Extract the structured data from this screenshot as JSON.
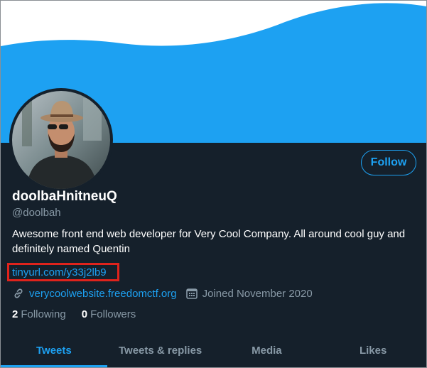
{
  "profile": {
    "display_name": "doolbaHnitneuQ",
    "handle": "@doolbah",
    "bio": "Awesome front end web developer for Very Cool Company. All around cool guy and definitely named Quentin",
    "bio_link": "tinyurl.com/y33j2lb9",
    "website": "verycoolwebsite.freedomctf.org",
    "joined": "Joined November 2020"
  },
  "actions": {
    "follow_label": "Follow"
  },
  "stats": {
    "following_count": "2",
    "following_label": "Following",
    "followers_count": "0",
    "followers_label": "Followers"
  },
  "tabs": [
    {
      "label": "Tweets",
      "active": true
    },
    {
      "label": "Tweets & replies",
      "active": false
    },
    {
      "label": "Media",
      "active": false
    },
    {
      "label": "Likes",
      "active": false
    }
  ],
  "icons": {
    "website": "link-icon",
    "joined": "calendar-icon"
  },
  "colors": {
    "background": "#15202b",
    "accent": "#1da1f2",
    "secondary_text": "#8899a6",
    "highlight_box": "#e0231c"
  }
}
